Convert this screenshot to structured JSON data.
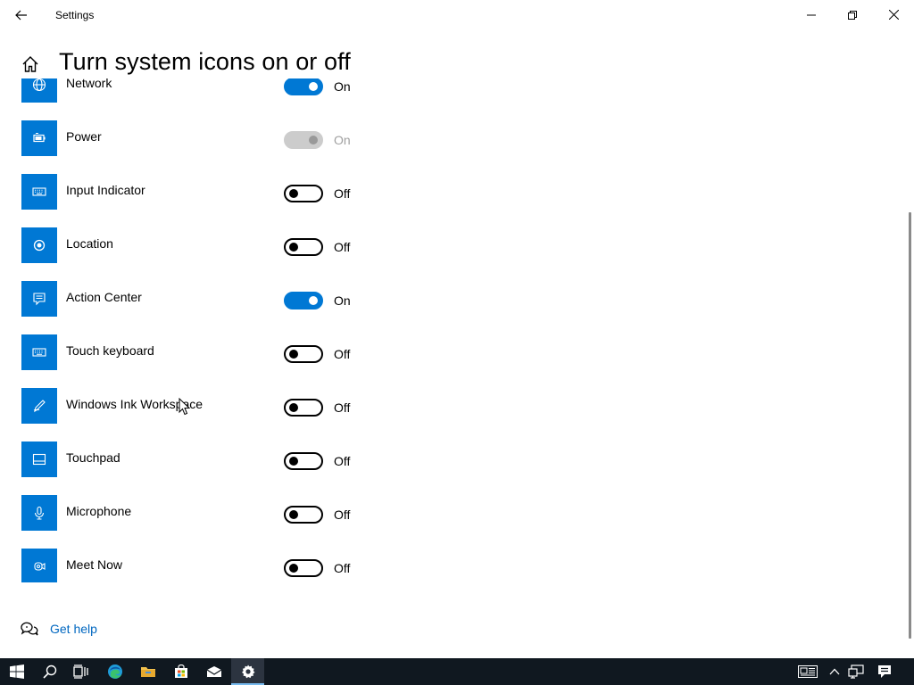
{
  "window": {
    "title": "Settings"
  },
  "header": {
    "title": "Turn system icons on or off"
  },
  "colors": {
    "accent": "#0078d4",
    "link": "#0067c0",
    "taskbar": "#101820"
  },
  "items": [
    {
      "label": "Network",
      "state": "On",
      "icon": "network-icon",
      "on": true,
      "disabled": false
    },
    {
      "label": "Power",
      "state": "On",
      "icon": "battery-icon",
      "on": true,
      "disabled": true
    },
    {
      "label": "Input Indicator",
      "state": "Off",
      "icon": "keyboard-icon",
      "on": false,
      "disabled": false
    },
    {
      "label": "Location",
      "state": "Off",
      "icon": "location-icon",
      "on": false,
      "disabled": false
    },
    {
      "label": "Action Center",
      "state": "On",
      "icon": "action-center-icon",
      "on": true,
      "disabled": false
    },
    {
      "label": "Touch keyboard",
      "state": "Off",
      "icon": "keyboard-icon",
      "on": false,
      "disabled": false
    },
    {
      "label": "Windows Ink Workspace",
      "state": "Off",
      "icon": "pen-icon",
      "on": false,
      "disabled": false
    },
    {
      "label": "Touchpad",
      "state": "Off",
      "icon": "touchpad-icon",
      "on": false,
      "disabled": false
    },
    {
      "label": "Microphone",
      "state": "Off",
      "icon": "microphone-icon",
      "on": false,
      "disabled": false
    },
    {
      "label": "Meet Now",
      "state": "Off",
      "icon": "meet-now-icon",
      "on": false,
      "disabled": false
    }
  ],
  "help": {
    "label": "Get help"
  },
  "taskbar": {
    "apps": [
      "start-icon",
      "search-icon",
      "task-view-icon",
      "edge-icon",
      "file-explorer-icon",
      "store-icon",
      "mail-icon",
      "settings-icon"
    ],
    "active_app": "settings-icon",
    "tray": [
      "news-icon",
      "chevron-up-icon",
      "network-icon",
      "notification-icon"
    ]
  }
}
